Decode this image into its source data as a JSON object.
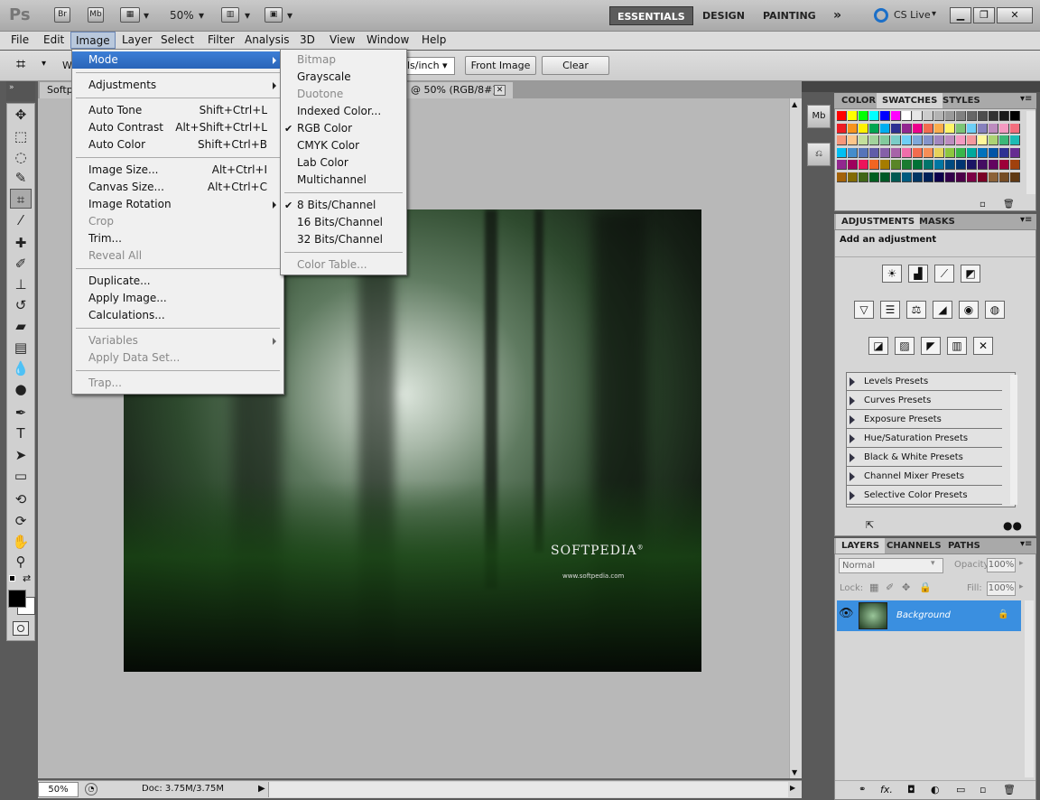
{
  "appbar": {
    "logo": "Ps",
    "br": "Br",
    "mb": "Mb",
    "zoom": "50%",
    "workspaces": [
      "ESSENTIALS",
      "DESIGN",
      "PAINTING"
    ],
    "more": "»",
    "cslive": "CS Live"
  },
  "menubar": [
    "File",
    "Edit",
    "Image",
    "Layer",
    "Select",
    "Filter",
    "Analysis",
    "3D",
    "View",
    "Window",
    "Help"
  ],
  "options": {
    "w_label": "W",
    "unit": "ls/inch",
    "front_image": "Front Image",
    "clear": "Clear"
  },
  "doc_tabs": {
    "left": "Softp",
    "right": "@ 50% (RGB/8#)"
  },
  "image_menu": {
    "items": [
      {
        "label": "Mode",
        "submenu": true,
        "highlight": true
      },
      {
        "sep": true
      },
      {
        "label": "Adjustments",
        "submenu": true
      },
      {
        "sep": true
      },
      {
        "label": "Auto Tone",
        "shortcut": "Shift+Ctrl+L"
      },
      {
        "label": "Auto Contrast",
        "shortcut": "Alt+Shift+Ctrl+L"
      },
      {
        "label": "Auto Color",
        "shortcut": "Shift+Ctrl+B"
      },
      {
        "sep": true
      },
      {
        "label": "Image Size...",
        "shortcut": "Alt+Ctrl+I"
      },
      {
        "label": "Canvas Size...",
        "shortcut": "Alt+Ctrl+C"
      },
      {
        "label": "Image Rotation",
        "submenu": true
      },
      {
        "label": "Crop",
        "disabled": true
      },
      {
        "label": "Trim..."
      },
      {
        "label": "Reveal All",
        "disabled": true
      },
      {
        "sep": true
      },
      {
        "label": "Duplicate..."
      },
      {
        "label": "Apply Image..."
      },
      {
        "label": "Calculations..."
      },
      {
        "sep": true
      },
      {
        "label": "Variables",
        "submenu": true,
        "disabled": true
      },
      {
        "label": "Apply Data Set...",
        "disabled": true
      },
      {
        "sep": true
      },
      {
        "label": "Trap...",
        "disabled": true
      }
    ]
  },
  "mode_menu": {
    "items": [
      {
        "label": "Bitmap",
        "disabled": true
      },
      {
        "label": "Grayscale"
      },
      {
        "label": "Duotone",
        "disabled": true
      },
      {
        "label": "Indexed Color..."
      },
      {
        "label": "RGB Color",
        "checked": true
      },
      {
        "label": "CMYK Color"
      },
      {
        "label": "Lab Color"
      },
      {
        "label": "Multichannel"
      },
      {
        "sep": true
      },
      {
        "label": "8 Bits/Channel",
        "checked": true
      },
      {
        "label": "16 Bits/Channel"
      },
      {
        "label": "32 Bits/Channel"
      },
      {
        "sep": true
      },
      {
        "label": "Color Table...",
        "disabled": true
      }
    ]
  },
  "photo": {
    "brand": "SOFTPEDIA",
    "reg": "®",
    "url": "www.softpedia.com"
  },
  "status": {
    "zoom": "50%",
    "doc": "Doc: 3.75M/3.75M"
  },
  "swatches_panel": {
    "tabs": [
      "COLOR",
      "SWATCHES",
      "STYLES"
    ],
    "colors": [
      "#ff0000",
      "#ffff00",
      "#00ff00",
      "#00ffff",
      "#0000ff",
      "#ff00ff",
      "#ffffff",
      "#e6e6e6",
      "#cccccc",
      "#b3b3b3",
      "#999999",
      "#808080",
      "#666666",
      "#4d4d4d",
      "#333333",
      "#1a1a1a",
      "#000000",
      "#ed1c24",
      "#f7941d",
      "#fff200",
      "#00a651",
      "#00aeef",
      "#2e3192",
      "#92278f",
      "#ec008c",
      "#f26c4f",
      "#fbad4c",
      "#fff568",
      "#7cc576",
      "#6dcff6",
      "#8781bd",
      "#bd8cbf",
      "#f49ac1",
      "#f26d7d",
      "#f7977a",
      "#fdc68a",
      "#c4df9b",
      "#a2d39c",
      "#82ca9d",
      "#7bcdc8",
      "#6ecff6",
      "#7ea7d8",
      "#8493ca",
      "#a187be",
      "#bc8dbf",
      "#f49ac2",
      "#f5989d",
      "#fff79a",
      "#acd373",
      "#3cb878",
      "#1cbbb4",
      "#00bff3",
      "#448ccb",
      "#5674b9",
      "#605ca8",
      "#855fa8",
      "#a763a8",
      "#f06eaa",
      "#f26c4f",
      "#f68e56",
      "#e6d35b",
      "#8dc63f",
      "#39b54a",
      "#00a99d",
      "#0072bc",
      "#0054a6",
      "#2e3192",
      "#662d91",
      "#92278f",
      "#9e005d",
      "#ed145b",
      "#f26522",
      "#a67c00",
      "#598527",
      "#1a7b30",
      "#007236",
      "#00746b",
      "#0076a3",
      "#004a80",
      "#003471",
      "#1b1464",
      "#440e62",
      "#630460",
      "#9e0039",
      "#a0410d",
      "#a36209",
      "#826b04",
      "#406618",
      "#005e20",
      "#005826",
      "#005952",
      "#005b7f",
      "#003663",
      "#002157",
      "#0d004c",
      "#32004b",
      "#4b0049",
      "#7b0046",
      "#7a0026",
      "#8c6239",
      "#754c24",
      "#603913"
    ],
    "rows": 7,
    "cols": 17
  },
  "adjustments_panel": {
    "tabs": [
      "ADJUSTMENTS",
      "MASKS"
    ],
    "heading": "Add an adjustment",
    "icons_row1": [
      "brightness-icon",
      "levels-icon",
      "curves-icon",
      "exposure-icon"
    ],
    "icons_row2": [
      "vibrance-icon",
      "hue-sat-icon",
      "color-balance-icon",
      "bw-icon",
      "photo-filter-icon",
      "channel-mixer-icon"
    ],
    "icons_row3": [
      "invert-icon",
      "posterize-icon",
      "threshold-icon",
      "gradient-map-icon",
      "selective-color-icon"
    ],
    "presets": [
      "Levels Presets",
      "Curves Presets",
      "Exposure Presets",
      "Hue/Saturation Presets",
      "Black & White Presets",
      "Channel Mixer Presets",
      "Selective Color Presets"
    ]
  },
  "layers_panel": {
    "tabs": [
      "LAYERS",
      "CHANNELS",
      "PATHS"
    ],
    "blend": "Normal",
    "opacity_label": "Opacity:",
    "opacity": "100%",
    "lock_label": "Lock:",
    "fill_label": "Fill:",
    "fill": "100%",
    "layer_name": "Background",
    "fx": "fx."
  }
}
